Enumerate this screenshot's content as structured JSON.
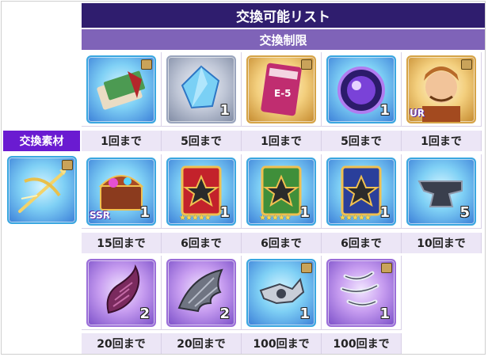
{
  "header": {
    "title": "交換可能リスト",
    "subtitle": "交換制限"
  },
  "material": {
    "label": "交換素材",
    "icon": "golden-crossbow-icon"
  },
  "rewards": [
    {
      "icon": "money-envelope-icon",
      "limit": "1回まで",
      "qty": ""
    },
    {
      "icon": "blue-crystal-icon",
      "limit": "5回まで",
      "qty": "1"
    },
    {
      "icon": "card-pack-icon",
      "limit": "1回まで",
      "qty": ""
    },
    {
      "icon": "purple-orb-icon",
      "limit": "5回まで",
      "qty": "1"
    },
    {
      "icon": "character-portrait-icon",
      "limit": "1回まで",
      "qty": "",
      "rank": "UR"
    },
    {
      "icon": "treasure-chest-icon",
      "limit": "15回まで",
      "qty": "1",
      "rank": "SSR"
    },
    {
      "icon": "red-tome-icon",
      "limit": "6回まで",
      "qty": "1",
      "stars": "★★★★★"
    },
    {
      "icon": "green-tome-icon",
      "limit": "6回まで",
      "qty": "1",
      "stars": "★★★★★"
    },
    {
      "icon": "blue-tome-icon",
      "limit": "6回まで",
      "qty": "1",
      "stars": "★★★★★"
    },
    {
      "icon": "anvil-icon",
      "limit": "10回まで",
      "qty": "5"
    },
    {
      "icon": "horn-icon",
      "limit": "20回まで",
      "qty": "2"
    },
    {
      "icon": "wing-icon",
      "limit": "20回まで",
      "qty": "2"
    },
    {
      "icon": "silver-gauntlet-icon",
      "limit": "100回まで",
      "qty": "1"
    },
    {
      "icon": "silver-claw-icon",
      "limit": "100回まで",
      "qty": "1"
    }
  ]
}
